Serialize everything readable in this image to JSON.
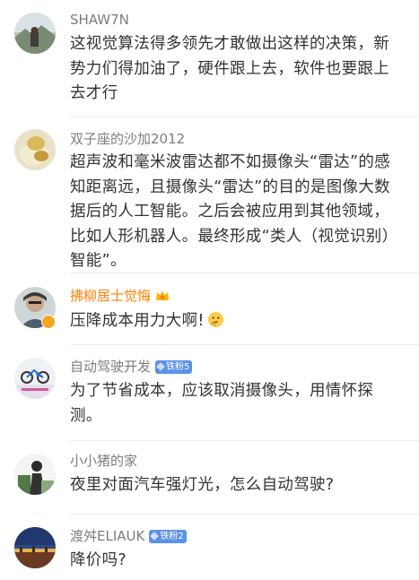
{
  "comments": [
    {
      "username": "SHAW7N",
      "text": "这视觉算法得多领先才敢做出这样的决策，新势力们得加油了，硬件跟上去，软件也要跟上去才行"
    },
    {
      "username": "双子座的沙加2012",
      "text": "超声波和毫米波雷达都不如摄像头“雷达”的感知距离远，且摄像头“雷达”的目的是图像大数据后的人工智能。之后会被应用到其他领域，比如人形机器人。最终形成“类人（视觉识别）智能”。"
    },
    {
      "username": "拂柳居士觉悔",
      "text": "压降成本用力大啊!"
    },
    {
      "username": "自动驾驶开发",
      "badge": "铁粉5",
      "text": "为了节省成本，应该取消摄像头，用情怀探测。"
    },
    {
      "username": "小小猪的家",
      "text": "夜里对面汽车强灯光，怎么自动驾驶?"
    },
    {
      "username": "渡舛ELIAUK",
      "badge": "铁粉2",
      "text": "降价吗?"
    }
  ]
}
